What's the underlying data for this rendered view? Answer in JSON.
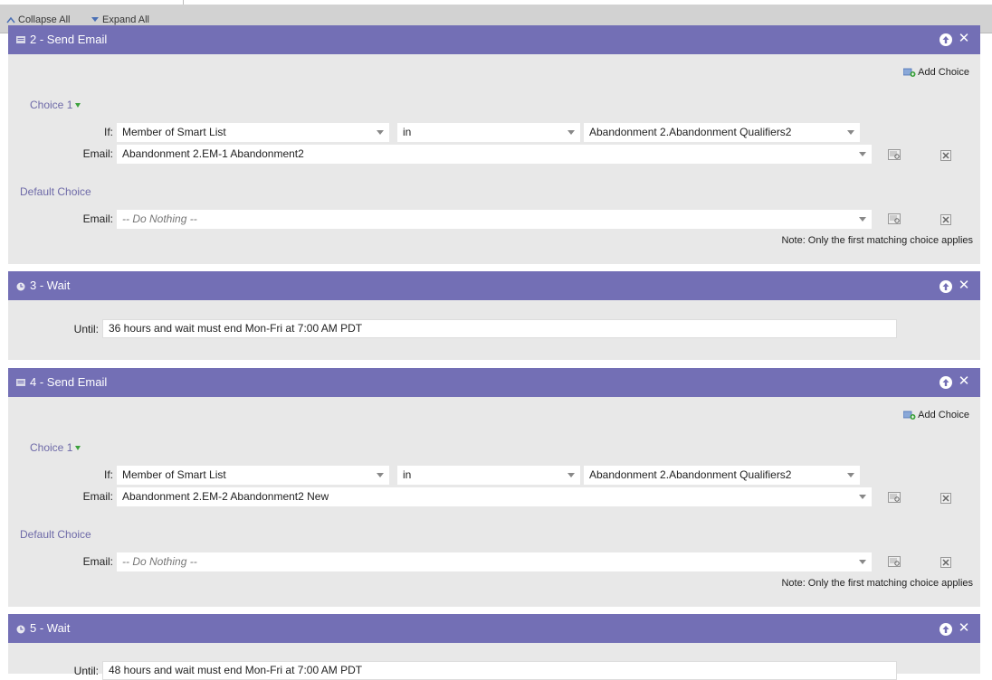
{
  "toolbar": {
    "collapse_all": "Collapse All",
    "expand_all": "Expand All"
  },
  "steps": [
    {
      "title": "2 - Send Email",
      "type": "send-email",
      "add_choice": "Add Choice",
      "choice_label": "Choice 1",
      "if_label": "If:",
      "condition_field": "Member of Smart List",
      "condition_operator": "in",
      "condition_value": "Abandonment 2.Abandonment Qualifiers2",
      "email_label": "Email:",
      "email_value": "Abandonment 2.EM-1 Abandonment2",
      "default_choice_label": "Default Choice",
      "default_email_label": "Email:",
      "default_email_value": "-- Do Nothing --",
      "note": "Note: Only the first matching choice applies"
    },
    {
      "title": "3 - Wait",
      "type": "wait",
      "until_label": "Until:",
      "until_value": "36 hours and wait must end Mon-Fri at 7:00 AM PDT"
    },
    {
      "title": "4 - Send Email",
      "type": "send-email",
      "add_choice": "Add Choice",
      "choice_label": "Choice 1",
      "if_label": "If:",
      "condition_field": "Member of Smart List",
      "condition_operator": "in",
      "condition_value": "Abandonment 2.Abandonment Qualifiers2",
      "email_label": "Email:",
      "email_value": "Abandonment 2.EM-2 Abandonment2 New",
      "default_choice_label": "Default Choice",
      "default_email_label": "Email:",
      "default_email_value": "-- Do Nothing --",
      "note": "Note: Only the first matching choice applies"
    },
    {
      "title": "5 - Wait",
      "type": "wait",
      "until_label": "Until:",
      "until_value": "48 hours and wait must end Mon-Fri at 7:00 AM PDT"
    }
  ],
  "colors": {
    "header": "#736fb5",
    "panel": "#e8e8e8",
    "link": "#6e6aa8",
    "toolbar": "#d2d2d2"
  }
}
